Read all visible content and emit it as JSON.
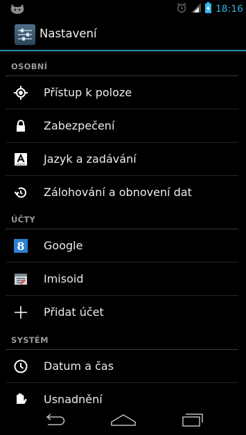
{
  "status_bar": {
    "time": "18:16",
    "notification_icon": "android-cat-icon",
    "icons": [
      "alarm-icon",
      "signal-icon",
      "battery-charging-icon"
    ]
  },
  "action_bar": {
    "title": "Nastavení",
    "icon": "settings-sliders-icon"
  },
  "sections": [
    {
      "header": "OSOBNÍ",
      "items": [
        {
          "label": "Přístup k poloze",
          "icon": "location-icon"
        },
        {
          "label": "Zabezpečení",
          "icon": "lock-icon"
        },
        {
          "label": "Jazyk a zadávání",
          "icon": "keyboard-a-icon"
        },
        {
          "label": "Zálohování a obnovení dat",
          "icon": "backup-restore-icon"
        }
      ]
    },
    {
      "header": "ÚČTY",
      "items": [
        {
          "label": "Google",
          "icon": "google-icon"
        },
        {
          "label": "Imisoid",
          "icon": "imisoid-icon"
        },
        {
          "label": "Přidat účet",
          "icon": "plus-icon"
        }
      ]
    },
    {
      "header": "SYSTÉM",
      "items": [
        {
          "label": "Datum a čas",
          "icon": "clock-icon"
        },
        {
          "label": "Usnadnění",
          "icon": "hand-icon"
        }
      ]
    }
  ],
  "nav_bar": {
    "buttons": [
      "back-icon",
      "home-icon",
      "recents-icon"
    ]
  },
  "colors": {
    "accent": "#33b5e5",
    "background": "#000000",
    "section_text": "#9a9a9a"
  }
}
